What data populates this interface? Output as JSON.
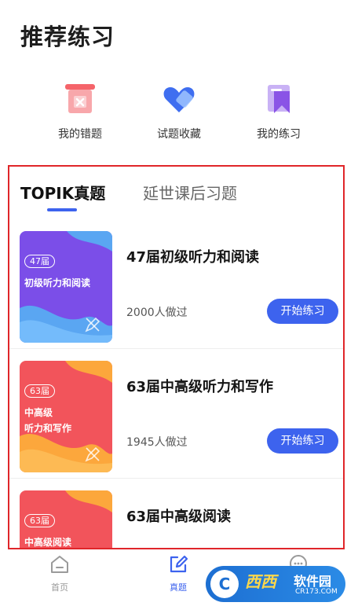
{
  "header": {
    "title": "推荐练习"
  },
  "shortcuts": [
    {
      "label": "我的错题",
      "icon": "wrong-questions-icon",
      "color": "#f5646a"
    },
    {
      "label": "试题收藏",
      "icon": "heart-favorite-icon",
      "color": "#3f6ef0"
    },
    {
      "label": "我的练习",
      "icon": "bookmark-practice-icon",
      "color": "#8a54e6"
    }
  ],
  "tabs": [
    {
      "label": "TOPIK真题",
      "active": true
    },
    {
      "label": "延世课后习题",
      "active": false
    }
  ],
  "exams": [
    {
      "badge": "47届",
      "thumb_lines": [
        "初级听力和阅读"
      ],
      "title": "47届初级听力和阅读",
      "count": "2000人做过",
      "button": "开始练习",
      "theme": "purple"
    },
    {
      "badge": "63届",
      "thumb_lines": [
        "中高级",
        "听力和写作"
      ],
      "title": "63届中高级听力和写作",
      "count": "1945人做过",
      "button": "开始练习",
      "theme": "red"
    },
    {
      "badge": "63届",
      "thumb_lines": [
        "中高级阅读"
      ],
      "title": "63届中高级阅读",
      "count": "",
      "button": "",
      "theme": "red"
    }
  ],
  "nav": [
    {
      "label": "首页",
      "icon": "home-icon",
      "active": false
    },
    {
      "label": "真题",
      "icon": "edit-icon",
      "active": true
    },
    {
      "label": "",
      "icon": "chat-icon",
      "active": false
    }
  ],
  "watermark": {
    "logo": "C",
    "name": "西西",
    "sub": "软件园",
    "url": "CR173.COM"
  },
  "colors": {
    "accent": "#3d63ee",
    "highlight_frame": "#e0262a",
    "purple_thumb": "#7b4ee8",
    "red_thumb": "#f2545b"
  }
}
